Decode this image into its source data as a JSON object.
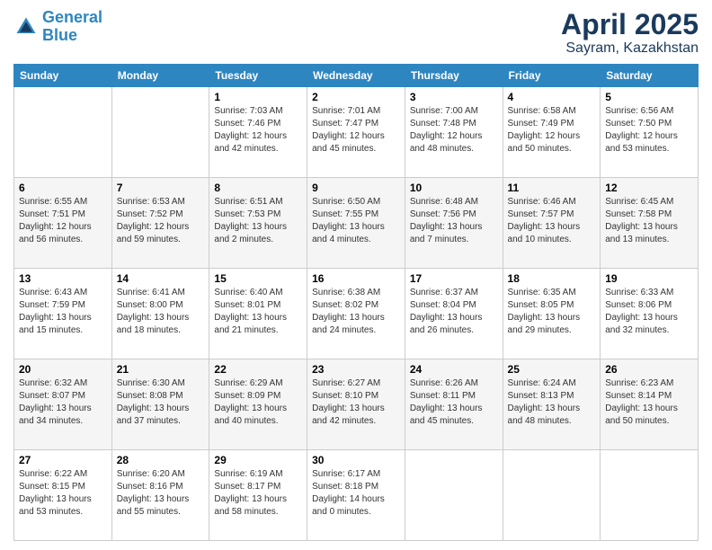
{
  "header": {
    "logo_line1": "General",
    "logo_line2": "Blue",
    "month": "April 2025",
    "location": "Sayram, Kazakhstan"
  },
  "weekdays": [
    "Sunday",
    "Monday",
    "Tuesday",
    "Wednesday",
    "Thursday",
    "Friday",
    "Saturday"
  ],
  "weeks": [
    [
      {
        "day": "",
        "info": ""
      },
      {
        "day": "",
        "info": ""
      },
      {
        "day": "1",
        "info": "Sunrise: 7:03 AM\nSunset: 7:46 PM\nDaylight: 12 hours and 42 minutes."
      },
      {
        "day": "2",
        "info": "Sunrise: 7:01 AM\nSunset: 7:47 PM\nDaylight: 12 hours and 45 minutes."
      },
      {
        "day": "3",
        "info": "Sunrise: 7:00 AM\nSunset: 7:48 PM\nDaylight: 12 hours and 48 minutes."
      },
      {
        "day": "4",
        "info": "Sunrise: 6:58 AM\nSunset: 7:49 PM\nDaylight: 12 hours and 50 minutes."
      },
      {
        "day": "5",
        "info": "Sunrise: 6:56 AM\nSunset: 7:50 PM\nDaylight: 12 hours and 53 minutes."
      }
    ],
    [
      {
        "day": "6",
        "info": "Sunrise: 6:55 AM\nSunset: 7:51 PM\nDaylight: 12 hours and 56 minutes."
      },
      {
        "day": "7",
        "info": "Sunrise: 6:53 AM\nSunset: 7:52 PM\nDaylight: 12 hours and 59 minutes."
      },
      {
        "day": "8",
        "info": "Sunrise: 6:51 AM\nSunset: 7:53 PM\nDaylight: 13 hours and 2 minutes."
      },
      {
        "day": "9",
        "info": "Sunrise: 6:50 AM\nSunset: 7:55 PM\nDaylight: 13 hours and 4 minutes."
      },
      {
        "day": "10",
        "info": "Sunrise: 6:48 AM\nSunset: 7:56 PM\nDaylight: 13 hours and 7 minutes."
      },
      {
        "day": "11",
        "info": "Sunrise: 6:46 AM\nSunset: 7:57 PM\nDaylight: 13 hours and 10 minutes."
      },
      {
        "day": "12",
        "info": "Sunrise: 6:45 AM\nSunset: 7:58 PM\nDaylight: 13 hours and 13 minutes."
      }
    ],
    [
      {
        "day": "13",
        "info": "Sunrise: 6:43 AM\nSunset: 7:59 PM\nDaylight: 13 hours and 15 minutes."
      },
      {
        "day": "14",
        "info": "Sunrise: 6:41 AM\nSunset: 8:00 PM\nDaylight: 13 hours and 18 minutes."
      },
      {
        "day": "15",
        "info": "Sunrise: 6:40 AM\nSunset: 8:01 PM\nDaylight: 13 hours and 21 minutes."
      },
      {
        "day": "16",
        "info": "Sunrise: 6:38 AM\nSunset: 8:02 PM\nDaylight: 13 hours and 24 minutes."
      },
      {
        "day": "17",
        "info": "Sunrise: 6:37 AM\nSunset: 8:04 PM\nDaylight: 13 hours and 26 minutes."
      },
      {
        "day": "18",
        "info": "Sunrise: 6:35 AM\nSunset: 8:05 PM\nDaylight: 13 hours and 29 minutes."
      },
      {
        "day": "19",
        "info": "Sunrise: 6:33 AM\nSunset: 8:06 PM\nDaylight: 13 hours and 32 minutes."
      }
    ],
    [
      {
        "day": "20",
        "info": "Sunrise: 6:32 AM\nSunset: 8:07 PM\nDaylight: 13 hours and 34 minutes."
      },
      {
        "day": "21",
        "info": "Sunrise: 6:30 AM\nSunset: 8:08 PM\nDaylight: 13 hours and 37 minutes."
      },
      {
        "day": "22",
        "info": "Sunrise: 6:29 AM\nSunset: 8:09 PM\nDaylight: 13 hours and 40 minutes."
      },
      {
        "day": "23",
        "info": "Sunrise: 6:27 AM\nSunset: 8:10 PM\nDaylight: 13 hours and 42 minutes."
      },
      {
        "day": "24",
        "info": "Sunrise: 6:26 AM\nSunset: 8:11 PM\nDaylight: 13 hours and 45 minutes."
      },
      {
        "day": "25",
        "info": "Sunrise: 6:24 AM\nSunset: 8:13 PM\nDaylight: 13 hours and 48 minutes."
      },
      {
        "day": "26",
        "info": "Sunrise: 6:23 AM\nSunset: 8:14 PM\nDaylight: 13 hours and 50 minutes."
      }
    ],
    [
      {
        "day": "27",
        "info": "Sunrise: 6:22 AM\nSunset: 8:15 PM\nDaylight: 13 hours and 53 minutes."
      },
      {
        "day": "28",
        "info": "Sunrise: 6:20 AM\nSunset: 8:16 PM\nDaylight: 13 hours and 55 minutes."
      },
      {
        "day": "29",
        "info": "Sunrise: 6:19 AM\nSunset: 8:17 PM\nDaylight: 13 hours and 58 minutes."
      },
      {
        "day": "30",
        "info": "Sunrise: 6:17 AM\nSunset: 8:18 PM\nDaylight: 14 hours and 0 minutes."
      },
      {
        "day": "",
        "info": ""
      },
      {
        "day": "",
        "info": ""
      },
      {
        "day": "",
        "info": ""
      }
    ]
  ]
}
